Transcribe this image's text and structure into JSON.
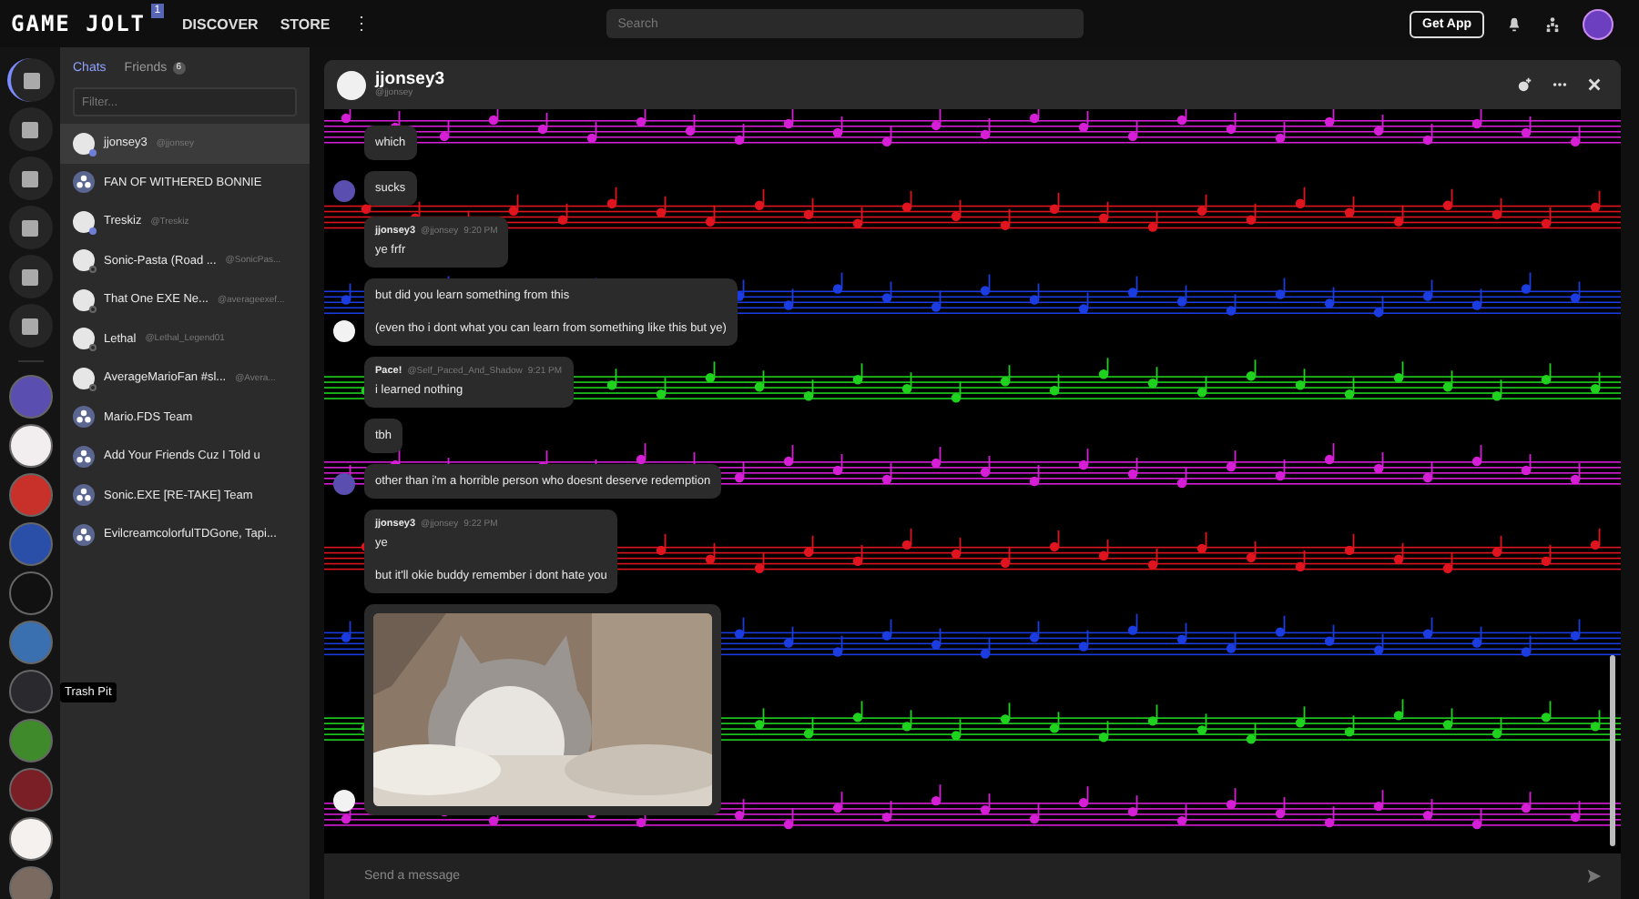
{
  "topbar": {
    "logo": "GAME JOLT",
    "logo_badge": "1",
    "nav": [
      "DISCOVER",
      "STORE"
    ],
    "more": "⋮",
    "search": {
      "placeholder": "Search"
    },
    "get_app": "Get App"
  },
  "rail": {
    "communities": [
      {
        "color": "#5a4fb0"
      },
      {
        "color": "#f2eef0"
      },
      {
        "color": "#c8302a"
      },
      {
        "color": "#2a4fa8"
      },
      {
        "color": "#111111"
      },
      {
        "color": "#3a6fb0"
      },
      {
        "color": "#2a2a2e",
        "tooltip": "Trash Pit"
      },
      {
        "color": "#3f8a2a"
      },
      {
        "color": "#7a1f25"
      },
      {
        "color": "#f4f1ee"
      },
      {
        "color": "#7a6a60"
      }
    ]
  },
  "chat_list": {
    "tabs": [
      {
        "label": "Chats",
        "selected": true
      },
      {
        "label": "Friends",
        "selected": false,
        "count": "6"
      }
    ],
    "filter": {
      "placeholder": "Filter..."
    },
    "items": [
      {
        "kind": "user",
        "name": "jjonsey3",
        "handle": "@jjonsey",
        "online": true,
        "selected": true
      },
      {
        "kind": "group",
        "name": "FAN OF WITHERED BONNIE",
        "selected": false
      },
      {
        "kind": "user",
        "name": "Treskiz",
        "handle": "@Treskiz",
        "online": true,
        "selected": false
      },
      {
        "kind": "user",
        "name": "Sonic-Pasta (Road ...",
        "handle": "@SonicPas...",
        "online": false,
        "selected": false
      },
      {
        "kind": "user",
        "name": "That One EXE Ne...",
        "handle": "@averageexef...",
        "online": false,
        "selected": false
      },
      {
        "kind": "user",
        "name": "Lethal",
        "handle": "@Lethal_Legend01",
        "online": false,
        "selected": false
      },
      {
        "kind": "user",
        "name": "AverageMarioFan #sl...",
        "handle": "@Avera...",
        "online": false,
        "selected": false
      },
      {
        "kind": "group",
        "name": "Mario.FDS Team",
        "selected": false
      },
      {
        "kind": "group",
        "name": "Add Your Friends Cuz I Told u",
        "selected": false
      },
      {
        "kind": "group",
        "name": "Sonic.EXE [RE-TAKE] Team",
        "selected": false
      },
      {
        "kind": "group",
        "name": "EvilcreamcolorfulTDGone, Tapi...",
        "selected": false
      }
    ]
  },
  "chat": {
    "title": "jjonsey3",
    "handle": "@jjonsey",
    "input": {
      "placeholder": "Send a message"
    },
    "messages": [
      {
        "kind": "text",
        "lines": [
          "which"
        ],
        "avatar": false
      },
      {
        "kind": "text",
        "lines": [
          "sucks"
        ],
        "avatar": true,
        "color": "#5a4fb0"
      },
      {
        "kind": "text",
        "author": "jjonsey3",
        "handle": "@jjonsey",
        "time": "9:20 PM",
        "lines": [
          "ye frfr"
        ],
        "avatar": false
      },
      {
        "kind": "text",
        "lines": [
          "but did you learn something from this",
          "(even tho i dont what you can learn from something like this but ye)"
        ],
        "avatar": true,
        "color": "#f2f2f2"
      },
      {
        "kind": "text",
        "author": "Pace!",
        "handle": "@Self_Paced_And_Shadow",
        "time": "9:21 PM",
        "lines": [
          "i learned nothing"
        ],
        "avatar": false
      },
      {
        "kind": "text",
        "lines": [
          "tbh"
        ],
        "avatar": false
      },
      {
        "kind": "text",
        "lines": [
          "other than i'm a horrible person who doesnt deserve redemption"
        ],
        "avatar": true,
        "color": "#5a4fb0"
      },
      {
        "kind": "text",
        "author": "jjonsey3",
        "handle": "@jjonsey",
        "time": "9:22 PM",
        "lines": [
          "ye",
          "but it'll okie buddy remember i dont hate you"
        ],
        "avatar": false
      },
      {
        "kind": "gif",
        "avatar": true,
        "color": "#f2f2f2"
      }
    ]
  }
}
